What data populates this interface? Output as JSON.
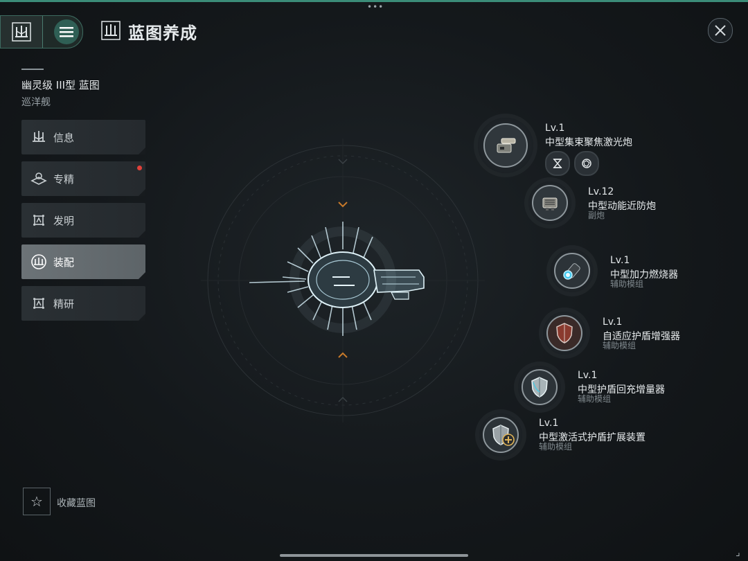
{
  "header": {
    "title": "蓝图养成",
    "top_dots": "•••"
  },
  "ship": {
    "name": "幽灵级 III型 蓝图",
    "class": "巡洋舰"
  },
  "nav": {
    "items": [
      {
        "label": "信息",
        "icon": "ship-silhouette-icon"
      },
      {
        "label": "专精",
        "icon": "specialization-icon",
        "badge": true
      },
      {
        "label": "发明",
        "icon": "invention-icon"
      },
      {
        "label": "装配",
        "icon": "assembly-icon",
        "active": true
      },
      {
        "label": "精研",
        "icon": "research-icon"
      }
    ]
  },
  "favorite": {
    "label": "收藏蓝图",
    "icon": "star-icon"
  },
  "equipment": [
    {
      "level": "Lv.1",
      "name": "中型集束聚焦激光炮",
      "type": "",
      "icon": "laser-cannon-icon"
    },
    {
      "level": "Lv.12",
      "name": "中型动能近防炮",
      "type": "副炮",
      "icon": "point-defense-icon"
    },
    {
      "level": "Lv.1",
      "name": "中型加力燃烧器",
      "type": "辅助模组",
      "icon": "afterburner-icon"
    },
    {
      "level": "Lv.1",
      "name": "自适应护盾增强器",
      "type": "辅助模组",
      "icon": "shield-red-icon"
    },
    {
      "level": "Lv.1",
      "name": "中型护盾回充增量器",
      "type": "辅助模组",
      "icon": "shield-silver-icon"
    },
    {
      "level": "Lv.1",
      "name": "中型激活式护盾扩展装置",
      "type": "辅助模组",
      "icon": "shield-add-icon"
    }
  ],
  "sub_icons": [
    "hourglass-icon",
    "sphere-icon"
  ],
  "colors": {
    "accent": "#3b8c78",
    "badge": "#e0413a",
    "nav_active": "#6c7377"
  }
}
